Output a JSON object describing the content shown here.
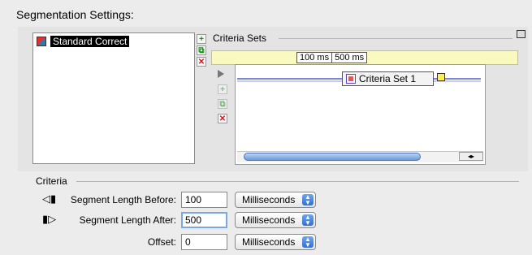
{
  "section_title": "Segmentation Settings:",
  "list": {
    "items": [
      {
        "label": "Standard Correct",
        "selected": true
      }
    ]
  },
  "criteria_sets": {
    "label": "Criteria Sets",
    "time_before": "100 ms",
    "time_after": "500 ms",
    "node_label": "Criteria Set 1"
  },
  "criteria": {
    "label": "Criteria",
    "fields": [
      {
        "label": "Segment Length Before:",
        "value": "100",
        "unit": "Milliseconds"
      },
      {
        "label": "Segment Length After:",
        "value": "500",
        "unit": "Milliseconds"
      },
      {
        "label": "Offset:",
        "value": "0",
        "unit": "Milliseconds"
      }
    ]
  },
  "icons": {
    "add": "plus-icon",
    "duplicate": "duplicate-icon",
    "delete": "delete-icon",
    "play": "play-icon",
    "collapse": "collapse-icon"
  },
  "colors": {
    "timebar": "#fafac0",
    "focus": "#7aa7e6",
    "select_arrow": "#2f6fd1",
    "node_icon": "#6a3fc0"
  }
}
